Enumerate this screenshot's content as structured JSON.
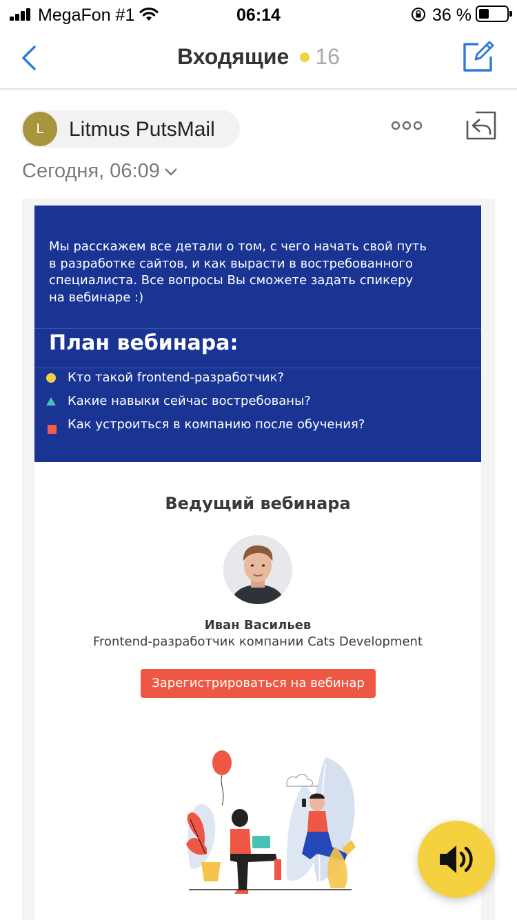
{
  "status_bar": {
    "carrier": "MegaFon #1",
    "time": "06:14",
    "battery_percent": "36 %",
    "battery_level": 0.36
  },
  "nav": {
    "title": "Входящие",
    "unread_count": "16"
  },
  "message": {
    "sender_initial": "L",
    "sender_name": "Litmus PutsMail",
    "date": "Сегодня, 06:09"
  },
  "email": {
    "intro_lines": [
      "Мы расскажем все детали о том, с чего начать свой путь",
      "в разработке сайтов, и как вырасти в востребованного",
      "специалиста. Все вопросы Вы сможете задать спикеру",
      "на вебинаре :)"
    ],
    "plan_title": "План вебинара:",
    "plan_items": [
      "Кто такой frontend-разработчик?",
      "Какие навыки сейчас востребованы?",
      "Как устроиться в компанию после обучения?"
    ],
    "host_title": "Ведущий вебинара",
    "host_name": "Иван Васильев",
    "host_role": "Frontend-разработчик компании Cats Development",
    "register_label": "Зарегистрироваться на вебинар"
  },
  "colors": {
    "email_blue": "#1a3494",
    "accent_red": "#ee5743",
    "ios_blue": "#2e7bd6",
    "unread_dot": "#f5d33e",
    "fab_yellow": "#f5d13f"
  },
  "icons": {
    "back": "chevron-left-icon",
    "compose": "compose-icon",
    "more": "more-dots-icon",
    "reply": "reply-icon",
    "date_expand": "chevron-down-icon",
    "audio": "speaker-icon"
  }
}
